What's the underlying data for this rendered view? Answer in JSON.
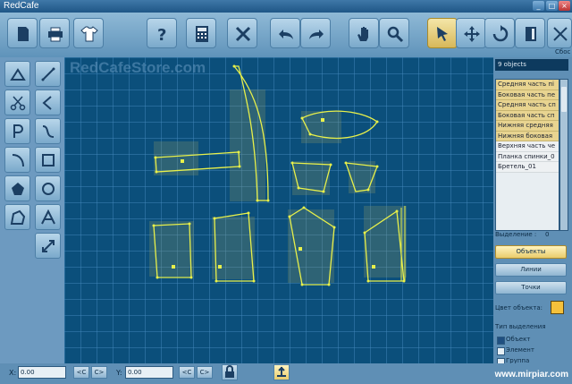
{
  "app": {
    "title": "RedCafe"
  },
  "window_buttons": {
    "minimize": "_",
    "maximize": "□",
    "close": "×"
  },
  "toolbar": {
    "buttons": [
      {
        "icon": "new-document-icon"
      },
      {
        "icon": "print-icon"
      },
      {
        "icon": "shirt-icon"
      },
      {
        "icon": "help-icon"
      },
      {
        "icon": "calculator-icon"
      },
      {
        "icon": "cut-icon"
      },
      {
        "icon": "undo-icon"
      },
      {
        "icon": "redo-icon"
      },
      {
        "icon": "hand-pan-icon"
      },
      {
        "icon": "zoom-icon"
      },
      {
        "icon": "select-arrow-icon",
        "active": true
      },
      {
        "icon": "move-icon"
      },
      {
        "icon": "rotate-icon"
      },
      {
        "icon": "mirror-icon"
      },
      {
        "icon": "reset-icon",
        "label": "Сбос"
      }
    ]
  },
  "left_tools": [
    {
      "icon": "triangle-icon"
    },
    {
      "icon": "line-tool-icon"
    },
    {
      "icon": "scissors-icon"
    },
    {
      "icon": "angle-icon"
    },
    {
      "icon": "p-tool-icon"
    },
    {
      "icon": "curve-icon"
    },
    {
      "icon": "arc-icon"
    },
    {
      "icon": "rectangle-icon"
    },
    {
      "icon": "polygon-fill-icon"
    },
    {
      "icon": "circle-icon"
    },
    {
      "icon": "freeform-polygon-icon"
    },
    {
      "icon": "text-tool-icon"
    },
    {
      "icon": "scale-arrow-icon"
    }
  ],
  "canvas": {
    "watermark": "RedCafeStore.com"
  },
  "right_panel": {
    "object_count": "9 objects",
    "objects": [
      "Средняя часть пі",
      "Боковая часть пе",
      "Средняя часть сп",
      "Боковая часть сп",
      "Нижняя средняя",
      "Нижняя боковая",
      "Верхняя часть че",
      "Планка спинки_0",
      "Бретель_01"
    ],
    "selection_label": "Выделение :",
    "selection_value": "0",
    "buttons": {
      "objects": "Объекты",
      "lines": "Линии",
      "points": "Точки"
    },
    "object_color_label": "Цвет объекта:",
    "object_color": "#f5c13b",
    "selection_type_label": "Тип выделения",
    "selection_types": [
      "Объект",
      "Элемент",
      "Группа"
    ]
  },
  "statusbar": {
    "x_label": "X:",
    "x_value": "0.00",
    "y_label": "Y:",
    "y_value": "0.00",
    "prev": "<C",
    "next": "C>",
    "site": "www.mirpiar.com"
  },
  "colors": {
    "canvas_bg": "#0b4f7b",
    "pattern_line": "#e8f04a",
    "accent": "#e9cc6c"
  }
}
